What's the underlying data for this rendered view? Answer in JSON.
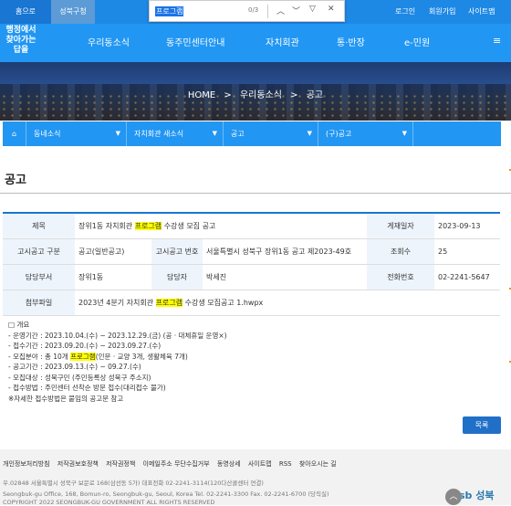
{
  "topbar": {
    "home": "홈으로",
    "sb": "성북구청",
    "login": "로그인",
    "join": "회원가입",
    "sitemap": "사이트맵"
  },
  "find": {
    "query": "프로그램",
    "count": "0/3"
  },
  "logo": {
    "lines": [
      "행정에서",
      "찾아가는",
      "답을"
    ],
    "accent": "#2196f3"
  },
  "nav": {
    "items": [
      "우리동소식",
      "동주민센터안내",
      "자치회관",
      "통·반장",
      "e-민원"
    ]
  },
  "breadcrumb": {
    "home": "HOME",
    "sep": ">",
    "a": "우리동소식",
    "b": "공고"
  },
  "subnav": {
    "home_icon": "home-icon",
    "items": [
      "동네소식",
      "자치회관 새소식",
      "공고",
      "(구)공고"
    ]
  },
  "page": {
    "title": "공고"
  },
  "table": {
    "title_label": "제목",
    "title_pre": "장위1동 자치회관 ",
    "title_hl": "프로그램",
    "title_post": " 수강생 모집 공고",
    "date_label": "게재일자",
    "date": "2023-09-13",
    "type_label": "고시공고 구분",
    "type": "공고(일반공고)",
    "no_label": "고시공고 번호",
    "no": "서울특별시 성북구 장위1동 공고 제2023-49호",
    "views_label": "조회수",
    "views": "25",
    "dept_label": "담당부서",
    "dept": "장위1동",
    "person_label": "담당자",
    "person": "박세진",
    "phone_label": "전화번호",
    "phone": "02-2241-5647",
    "file_label": "첨부파일",
    "file_pre": "2023년 4분기 자치회관 ",
    "file_hl": "프로그램",
    "file_post": " 수강생 모집공고 1.hwpx"
  },
  "body": {
    "l1": "□ 개요",
    "l2": " - 운영기간 : 2023.10.04.(수) ~ 2023.12.29.(금) (공 · 대체휴일 운영×)",
    "l3": " - 접수기간 : 2023.09.20.(수) ~ 2023.09.27.(수)",
    "l4_pre": " - 모집분야 : 총 10개 ",
    "l4_hl": "프로그램",
    "l4_post": "(인문 · 교양 3개, 생활체육 7개)",
    "l5": " - 공고기간 : 2023.09.13.(수) ~ 09.27.(수)",
    "l6": " - 모집대상 : 성북구민 (주민등록상 성북구 주소지)",
    "l7": " - 접수방법 : 주민센터 선착순 방문 접수(대리접수 불가)",
    "l8": "※자세한 접수방법은 붙임의 공고문 참고"
  },
  "list_button": "목록",
  "footer": {
    "links": [
      "개인정보처리방침",
      "저작권보호정책",
      "저작권정책",
      "이메일주소 무단수집거부",
      "동영상세",
      "사이트맵",
      "RSS",
      "찾아오시는 길"
    ],
    "addr1": "우.02848 서울특별시 성북구 보문로 168(삼선동 5가) 대표전화 02-2241-3114(120다산콜센터 연결)",
    "addr2": "Seongbuk-gu Office, 168, Bomun-ro, Seongbuk-gu, Seoul, Korea Tel. 02-2241-3300 Fax. 02-2241-6700 (당직실)",
    "copy": "COPYRIGHT 2022 SEONGBUK-GU GOVERNMENT ALL RIGHTS RESERVED",
    "logo": "sb 성북"
  }
}
